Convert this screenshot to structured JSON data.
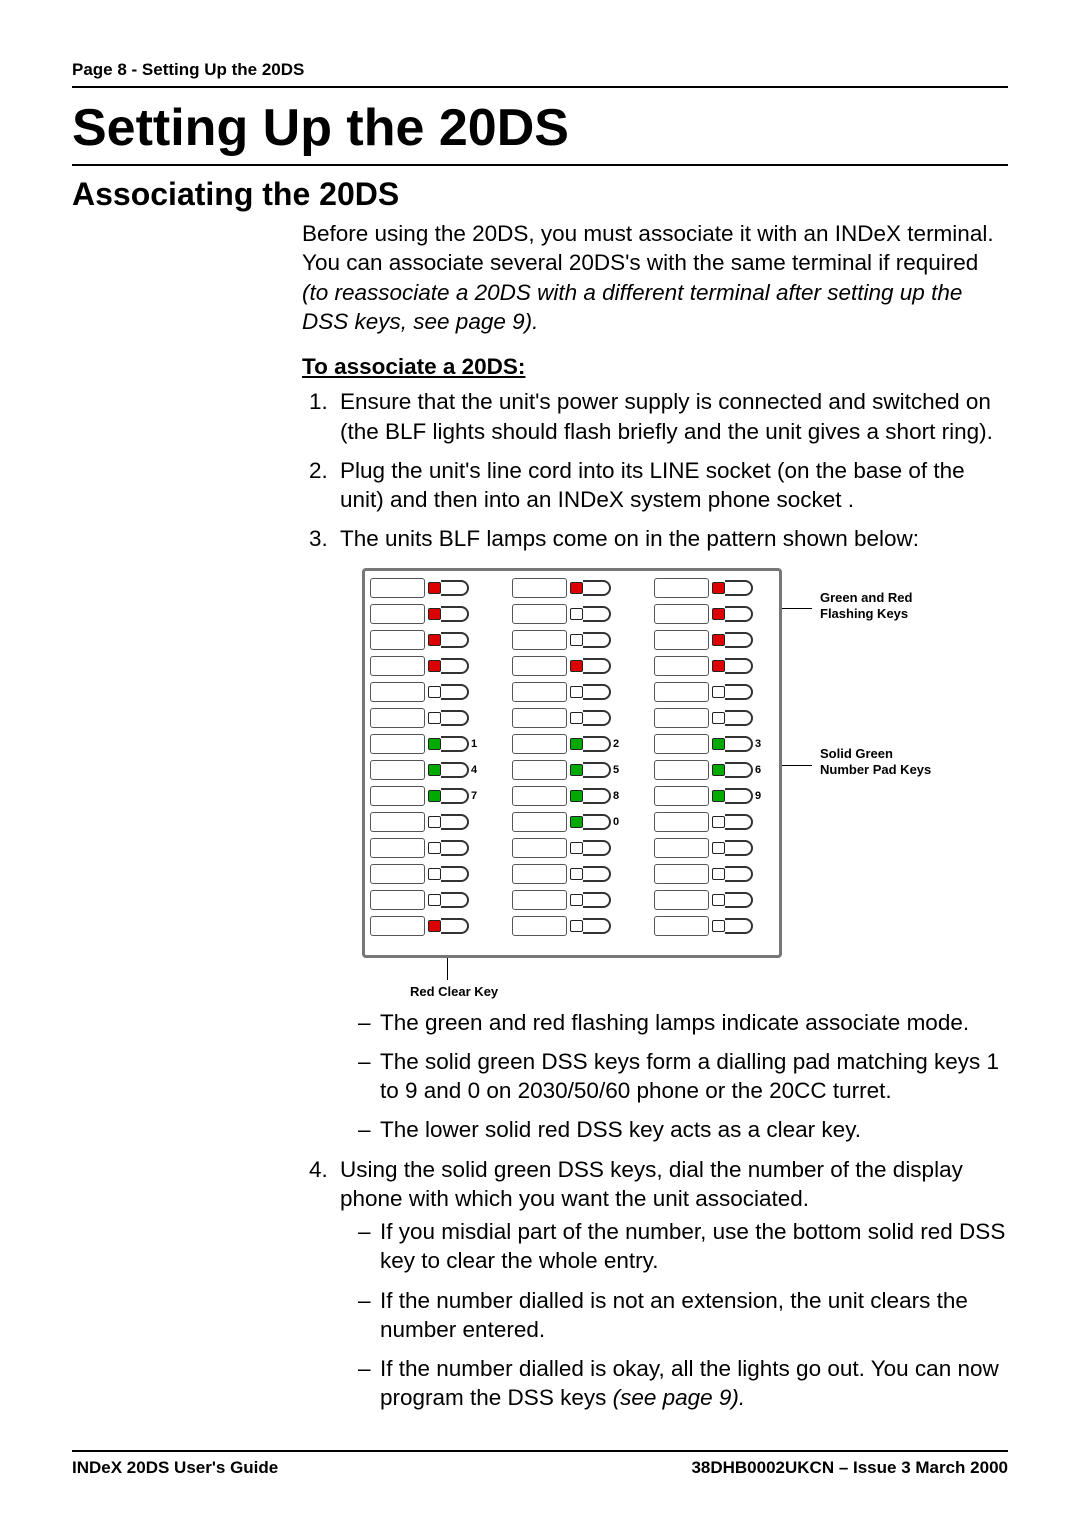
{
  "pageHeader": "Page 8 - Setting Up the 20DS",
  "title": "Setting Up the 20DS",
  "subheading": "Associating the 20DS",
  "intro_plain": "Before using the 20DS, you must associate it with an INDeX terminal. You can associate several 20DS's with the same terminal if required ",
  "intro_italic": "(to reassociate a 20DS with a different terminal after setting up the DSS keys, see page 9).",
  "instr_heading": "To associate a 20DS:",
  "steps": {
    "s1": "Ensure that the unit's power supply is connected and switched on (the BLF lights should flash briefly and the unit gives a short ring).",
    "s2": "Plug the unit's line cord into its LINE socket (on the base of the unit) and then into an INDeX system phone socket .",
    "s3": "The units BLF lamps come on in the pattern shown below:",
    "s3_sub": {
      "a": "The green and red flashing lamps indicate associate mode.",
      "b": "The solid green DSS keys form a dialling pad matching keys 1 to 9 and 0 on 2030/50/60 phone or the 20CC turret.",
      "c": "The lower solid red DSS key acts as a clear key."
    },
    "s4": "Using the solid green DSS keys, dial the number of the display phone with which you want the unit associated.",
    "s4_sub": {
      "a": "If you misdial part of the number, use the bottom solid red DSS key to clear the whole entry.",
      "b": "If the number dialled is not an extension, the unit clears the number entered.",
      "c_plain": "If the number dialled is okay, all the lights go out. You can now program the DSS keys ",
      "c_italic": "(see page 9)."
    }
  },
  "diagram": {
    "anno_top": "Green and Red Flashing  Keys",
    "anno_mid": "Solid Green Number Pad Keys",
    "anno_bottom": "Red Clear Key",
    "keys": [
      [
        "rg",
        "rg",
        "rg"
      ],
      [
        "rg",
        "off",
        "rg"
      ],
      [
        "rg",
        "off",
        "rg"
      ],
      [
        "rg",
        "rg",
        "rg"
      ],
      [
        "off",
        "off",
        "off"
      ],
      [
        "off",
        "off",
        "off"
      ],
      [
        "g:1",
        "g:2",
        "g:3"
      ],
      [
        "g:4",
        "g:5",
        "g:6"
      ],
      [
        "g:7",
        "g:8",
        "g:9"
      ],
      [
        "off",
        "g:0",
        "off"
      ],
      [
        "off",
        "off",
        "off"
      ],
      [
        "off",
        "off",
        "off"
      ],
      [
        "off",
        "off",
        "off"
      ],
      [
        "r",
        "off",
        "off"
      ]
    ]
  },
  "footer": {
    "left": "INDeX  20DS User's Guide",
    "right": "38DHB0002UKCN – Issue 3 March 2000"
  }
}
